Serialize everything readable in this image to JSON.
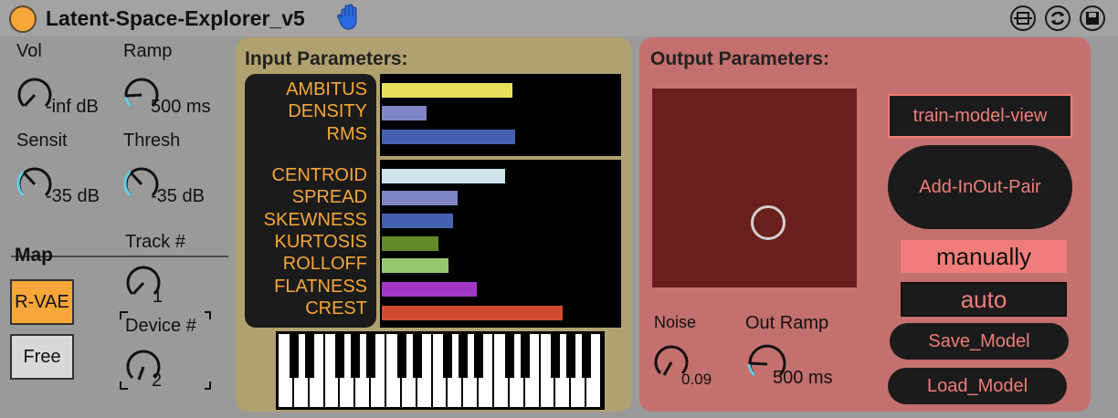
{
  "title": "Latent-Space-Explorer_v5",
  "left": {
    "vol": {
      "label": "Vol",
      "value": "-inf dB"
    },
    "ramp": {
      "label": "Ramp",
      "value": "500 ms"
    },
    "sensit": {
      "label": "Sensit",
      "value": "-35 dB"
    },
    "thresh": {
      "label": "Thresh",
      "value": "-35 dB"
    },
    "map": {
      "label": "Map",
      "rvae": "R-VAE",
      "free": "Free"
    },
    "track": {
      "label": "Track #",
      "value": "1"
    },
    "device": {
      "label": "Device #",
      "value": "2"
    }
  },
  "input": {
    "title": "Input Parameters:",
    "params": [
      {
        "name": "AMBITUS",
        "value": 0.55,
        "color": "#e8e05a"
      },
      {
        "name": "DENSITY",
        "value": 0.19,
        "color": "#7f86c2"
      },
      {
        "name": "RMS",
        "value": 0.56,
        "color": "#4660b0"
      },
      {
        "name": "CENTROID",
        "value": 0.52,
        "color": "#cfe3e8"
      },
      {
        "name": "SPREAD",
        "value": 0.32,
        "color": "#7f86c2"
      },
      {
        "name": "SKEWNESS",
        "value": 0.3,
        "color": "#4660b0"
      },
      {
        "name": "KURTOSIS",
        "value": 0.24,
        "color": "#638a2a"
      },
      {
        "name": "ROLLOFF",
        "value": 0.28,
        "color": "#95c86e"
      },
      {
        "name": "FLATNESS",
        "value": 0.4,
        "color": "#a436c6"
      },
      {
        "name": "CREST",
        "value": 0.76,
        "color": "#d24a30"
      }
    ]
  },
  "output": {
    "title": "Output Parameters:",
    "train_button": "train-model-view",
    "add_button": "Add-InOut-Pair",
    "manually": "manually",
    "auto": "auto",
    "save_button": "Save_Model",
    "load_button": "Load_Model",
    "noise": {
      "label": "Noise",
      "value": "0.09"
    },
    "out_ramp": {
      "label": "Out Ramp",
      "value": "500 ms"
    }
  },
  "colors": {
    "accent": "#f7a63a",
    "output_text": "#f07d7a",
    "knob_arc": "#5fd0e8"
  }
}
